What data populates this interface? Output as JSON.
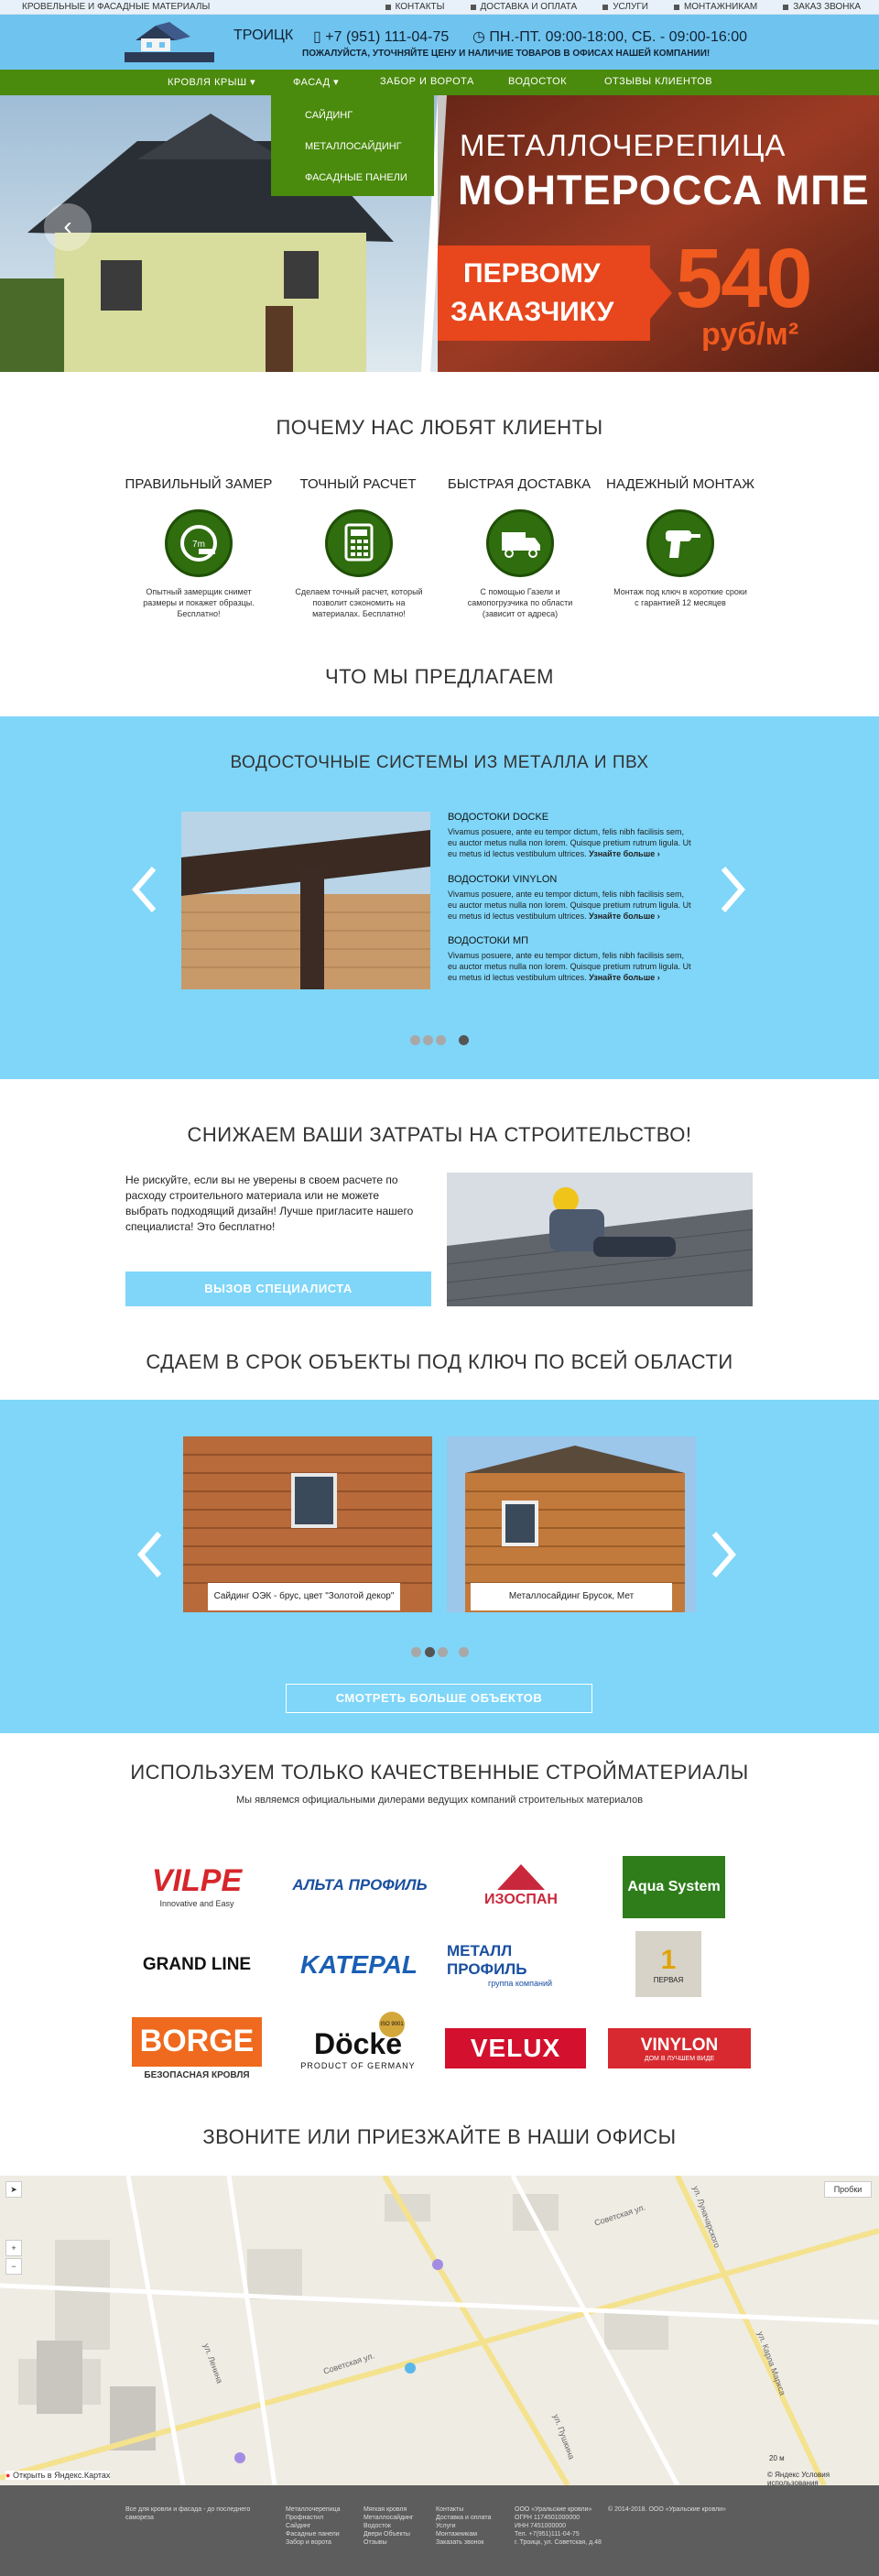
{
  "topbar": {
    "tagline": "КРОВЕЛЬНЫЕ И ФАСАДНЫЕ МАТЕРИАЛЫ",
    "links": [
      "КОНТАКТЫ",
      "ДОСТАВКА И ОПЛАТА",
      "УСЛУГИ",
      "МОНТАЖНИКАМ",
      "ЗАКАЗ ЗВОНКА"
    ]
  },
  "header": {
    "city": "ТРОИЦК",
    "phone": "+7 (951) 111-04-75",
    "hours": "ПН.-ПТ. 09:00-18:00, СБ. - 09:00-16:00",
    "notice": "ПОЖАЛУЙСТА, УТОЧНЯЙТЕ ЦЕНУ И НАЛИЧИЕ ТОВАРОВ В ОФИСАХ НАШЕЙ КОМПАНИИ!"
  },
  "nav": {
    "items": [
      "КРОВЛЯ КРЫШ",
      "ФАСАД",
      "ЗАБОР И ВОРОТА",
      "ВОДОСТОК",
      "ОТЗЫВЫ КЛИЕНТОВ"
    ],
    "dropdown": [
      "САЙДИНГ",
      "МЕТАЛЛОСАЙДИНГ",
      "ФАСАДНЫЕ ПАНЕЛИ"
    ]
  },
  "hero": {
    "line1": "МЕТАЛЛОЧЕРЕПИЦА",
    "line2": "МОНТЕРОССА МПЕ",
    "promo1": "ПЕРВОМУ",
    "promo2": "ЗАКАЗЧИКУ",
    "price": "540",
    "unit": "руб/м²"
  },
  "why": {
    "title": "ПОЧЕМУ НАС ЛЮБЯТ КЛИЕНТЫ",
    "features": [
      {
        "title": "ПРАВИЛЬНЫЙ ЗАМЕР",
        "text": "Опытный замерщик снимет размеры и покажет образцы. Бесплатно!",
        "icon": "tape-measure-icon"
      },
      {
        "title": "ТОЧНЫЙ РАСЧЕТ",
        "text": "Сделаем точный расчет, который позволит сэкономить на материалах. Бесплатно!",
        "icon": "calculator-icon"
      },
      {
        "title": "БЫСТРАЯ ДОСТАВКА",
        "text": "С помощью Газели и самопогрузчика по области (зависит от адреса)",
        "icon": "truck-icon"
      },
      {
        "title": "НАДЕЖНЫЙ МОНТАЖ",
        "text": "Монтаж под ключ в короткие сроки с гарантией 12 месяцев",
        "icon": "drill-icon"
      }
    ]
  },
  "offer": {
    "title": "ЧТО МЫ ПРЕДЛАГАЕМ"
  },
  "gutters": {
    "title": "ВОДОСТОЧНЫЕ СИСТЕМЫ ИЗ МЕТАЛЛА И ПВХ",
    "items": [
      {
        "name": "ВОДОСТОКИ DOCKE",
        "text": "Vivamus posuere, ante eu tempor dictum, felis nibh facilisis sem, eu auctor metus nulla non lorem. Quisque pretium rutrum ligula. Ut eu metus id lectus vestibulum ultrices.",
        "more": "Узнайте больше ›"
      },
      {
        "name": "ВОДОСТОКИ VINYLON",
        "text": "Vivamus posuere, ante eu tempor dictum, felis nibh facilisis sem, eu auctor metus nulla non lorem. Quisque pretium rutrum ligula. Ut eu metus id lectus vestibulum ultrices.",
        "more": "Узнайте больше ›"
      },
      {
        "name": "ВОДОСТОКИ МП",
        "text": "Vivamus posuere, ante eu tempor dictum, felis nibh facilisis sem, eu auctor metus nulla non lorem. Quisque pretium rutrum ligula. Ut eu metus id lectus vestibulum ultrices.",
        "more": "Узнайте больше ›"
      }
    ]
  },
  "savings": {
    "title": "СНИЖАЕМ ВАШИ ЗАТРАТЫ НА СТРОИТЕЛЬСТВО!",
    "text": "Не рискуйте, если вы не уверены в своем расчете по расходу строительного материала или не можете выбрать подходящий дизайн! Лучше пригласите нашего специалиста! Это бесплатно!",
    "button": "ВЫЗОВ СПЕЦИАЛИСТА"
  },
  "projects": {
    "title": "СДАЕМ В СРОК ОБЪЕКТЫ ПОД КЛЮЧ ПО ВСЕЙ ОБЛАСТИ",
    "captions": [
      "Сайдинг ОЭК - брус, цвет \"Золотой декор\"",
      "Металлосайдинг Брусок, Мет"
    ],
    "button": "СМОТРЕТЬ БОЛЬШЕ ОБЪЕКТОВ"
  },
  "brands": {
    "title": "ИСПОЛЬЗУЕМ ТОЛЬКО КАЧЕСТВЕННЫЕ СТРОЙМАТЕРИАЛЫ",
    "subtitle": "Мы являемся официальными дилерами ведущих компаний строительных материалов",
    "vilpe": "VILPE",
    "vilpe_sub": "Innovative and Easy",
    "altaprofil": "АЛЬТА ПРОФИЛЬ",
    "izospan": "ИЗОСПАН",
    "aquasystem": "Aqua System",
    "grandline": "GRAND LINE",
    "katepal": "KATEPAL",
    "metallprofil": "МЕТАЛЛ ПРОФИЛЬ",
    "metallprofil_sub": "группа компаний",
    "pervaya": "ПЕРВАЯ",
    "borge": "BORGE",
    "borge_sub": "БЕЗОПАСНАЯ КРОВЛЯ",
    "docke": "Döcke",
    "docke_sub": "PRODUCT OF GERMANY",
    "iso": "ISO 9001",
    "velux": "VELUX",
    "vinylon": "VINYLON",
    "vinylon_sub": "ДОМ В ЛУЧШЕМ ВИДЕ"
  },
  "contacts": {
    "title": "ЗВОНИТЕ ИЛИ ПРИЕЗЖАЙТЕ В НАШИ ОФИСЫ"
  },
  "map": {
    "traffic": "Пробки",
    "plus": "+",
    "minus": "−",
    "open_link": "Открыть в Яндекс.Картах",
    "copyright": "© Яндекс Условия использования",
    "scale": "20 м",
    "streets": [
      "Советская ул.",
      "Советская ул.",
      "ул. Луначарского",
      "ул. Карла Маркса",
      "ул. Ленина",
      "ул. Пушкина"
    ]
  },
  "footer": {
    "c1": "Все для кровли и фасада - до последнего самореза",
    "c2": [
      "Металлочерепица",
      "Профнастил",
      "Сайдинг",
      "Фасадные панели",
      "Забор и ворота"
    ],
    "c3": [
      "Мягкая кровля",
      "Металлосайдинг",
      "Водосток",
      "Двери Объекты",
      "Отзывы"
    ],
    "c4": [
      "Контакты",
      "Доставка и оплата",
      "Услуги",
      "Монтажникам",
      "Заказать звонок"
    ],
    "c5": [
      "ООО «Уральские кровли»",
      "ОГРН 1174501000000",
      "ИНН 7451000000",
      "Тел. +7(951)111-04-75",
      "г. Троицк, ул. Советская, д.48"
    ],
    "copy": "© 2014-2018. ООО «Уральские кровли»"
  }
}
